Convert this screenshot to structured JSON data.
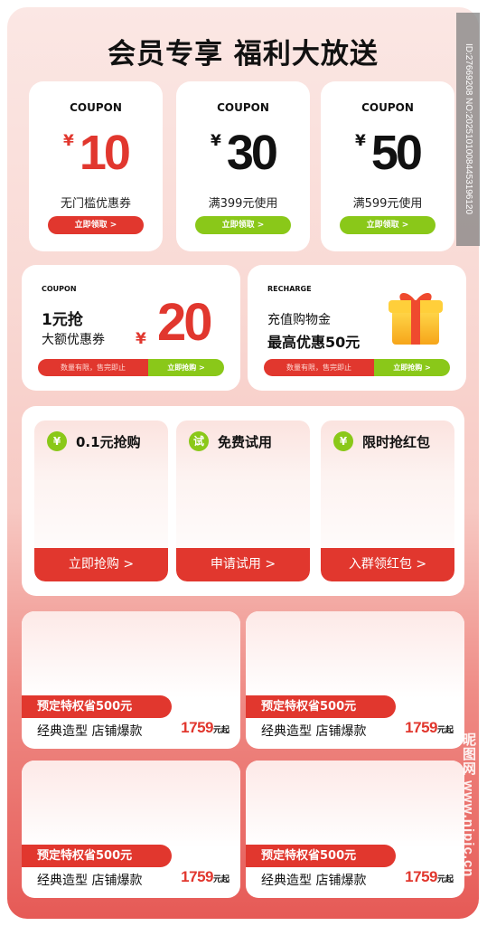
{
  "title": "会员专享 福利大放送",
  "colors": {
    "accent_red": "#e1372e",
    "accent_green": "#8ac819"
  },
  "coupons": [
    {
      "label": "COUPON",
      "currency": "¥",
      "amount": "10",
      "desc": "无门槛优惠券",
      "button": "立即领取 >"
    },
    {
      "label": "COUPON",
      "currency": "¥",
      "amount": "30",
      "desc": "满399元使用",
      "button": "立即领取 >"
    },
    {
      "label": "COUPON",
      "currency": "¥",
      "amount": "50",
      "desc": "满599元使用",
      "button": "立即领取 >"
    }
  ],
  "promo_left": {
    "tag": "COUPON",
    "line1": "1元抢",
    "line2": "大额优惠券",
    "currency": "¥",
    "amount": "20",
    "bar_left": "数量有限，售完即止",
    "bar_right": "立即抢购 >"
  },
  "promo_right": {
    "tag": "RECHARGE",
    "line1": "充值购物金",
    "line2": "最高优惠50元",
    "bar_left": "数量有限，售完即止",
    "bar_right": "立即抢购 >"
  },
  "activities": [
    {
      "icon": "¥",
      "title": "0.1元抢购",
      "button": "立即抢购 >"
    },
    {
      "icon": "试",
      "title": "免费试用",
      "button": "申请试用 >"
    },
    {
      "icon": "¥",
      "title": "限时抢红包",
      "button": "入群领红包 >"
    }
  ],
  "products": [
    {
      "promo": "预定特权省500元",
      "name": "经典造型 店铺爆款",
      "price": "1759",
      "unit": "元起"
    },
    {
      "promo": "预定特权省500元",
      "name": "经典造型 店铺爆款",
      "price": "1759",
      "unit": "元起"
    },
    {
      "promo": "预定特权省500元",
      "name": "经典造型 店铺爆款",
      "price": "1759",
      "unit": "元起"
    },
    {
      "promo": "预定特权省500元",
      "name": "经典造型 店铺爆款",
      "price": "1759",
      "unit": "元起"
    }
  ],
  "watermark_id": "ID:27669208 NO:20251010084453196120",
  "watermark_site": "昵图网 www.nipic.cn"
}
